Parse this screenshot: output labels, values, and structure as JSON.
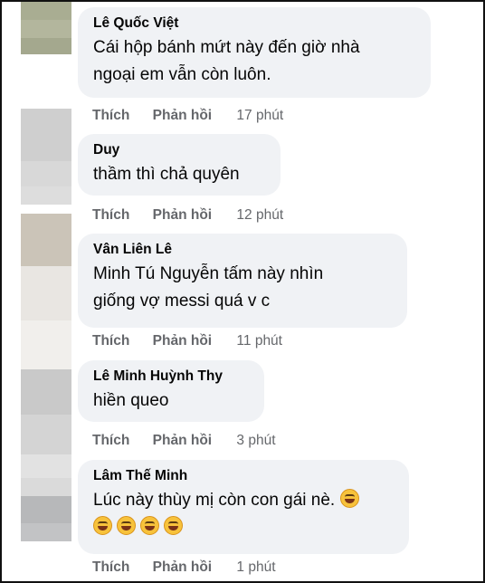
{
  "colors": {
    "bubble_bg": "#f0f2f5",
    "name_text": "#050505",
    "meta_text": "#65676b",
    "frame_border": "#111111"
  },
  "comments": [
    {
      "author": "Lê Quốc Việt",
      "lines": [
        "Cái hộp bánh mứt này đến giờ nhà",
        "ngoại em vẫn còn luôn."
      ],
      "like_label": "Thích",
      "reply_label": "Phản hồi",
      "time": "17 phút",
      "avatar_colors": [
        "#a9ad92",
        "#b3b69d",
        "#a4a88e"
      ]
    },
    {
      "author": "Duy",
      "lines": [
        "thầm thì chả quyên"
      ],
      "like_label": "Thích",
      "reply_label": "Phản hồi",
      "time": "12 phút",
      "avatar_colors": [
        "#cfcfcf",
        "#d8d8d8",
        "#dddddd"
      ]
    },
    {
      "author": "Vân Liên Lê",
      "lines": [
        "Minh Tú Nguyễn tấm này nhìn",
        "giống vợ messi quá v c"
      ],
      "like_label": "Thích",
      "reply_label": "Phản hồi",
      "time": "11 phút",
      "avatar_colors": [
        "#cbc4b8",
        "#e9e6e2",
        "#f1efec"
      ]
    },
    {
      "author": "Lê Minh Huỳnh Thy",
      "lines": [
        "hiền queo"
      ],
      "like_label": "Thích",
      "reply_label": "Phản hồi",
      "time": "3 phút",
      "avatar_colors": [
        "#c9c9c9",
        "#d4d4d4",
        "#e2e2e2"
      ]
    },
    {
      "author": "Lâm Thế Minh",
      "lines": [
        "Lúc này thùy mị còn con gái nè.",
        ""
      ],
      "emoji_name": "rolling-on-the-floor-laughing-icon",
      "like_label": "Thích",
      "reply_label": "Phản hồi",
      "time": "1 phút",
      "avatar_colors": [
        "#dadada",
        "#b7b8ba",
        "#c2c3c5"
      ]
    }
  ]
}
